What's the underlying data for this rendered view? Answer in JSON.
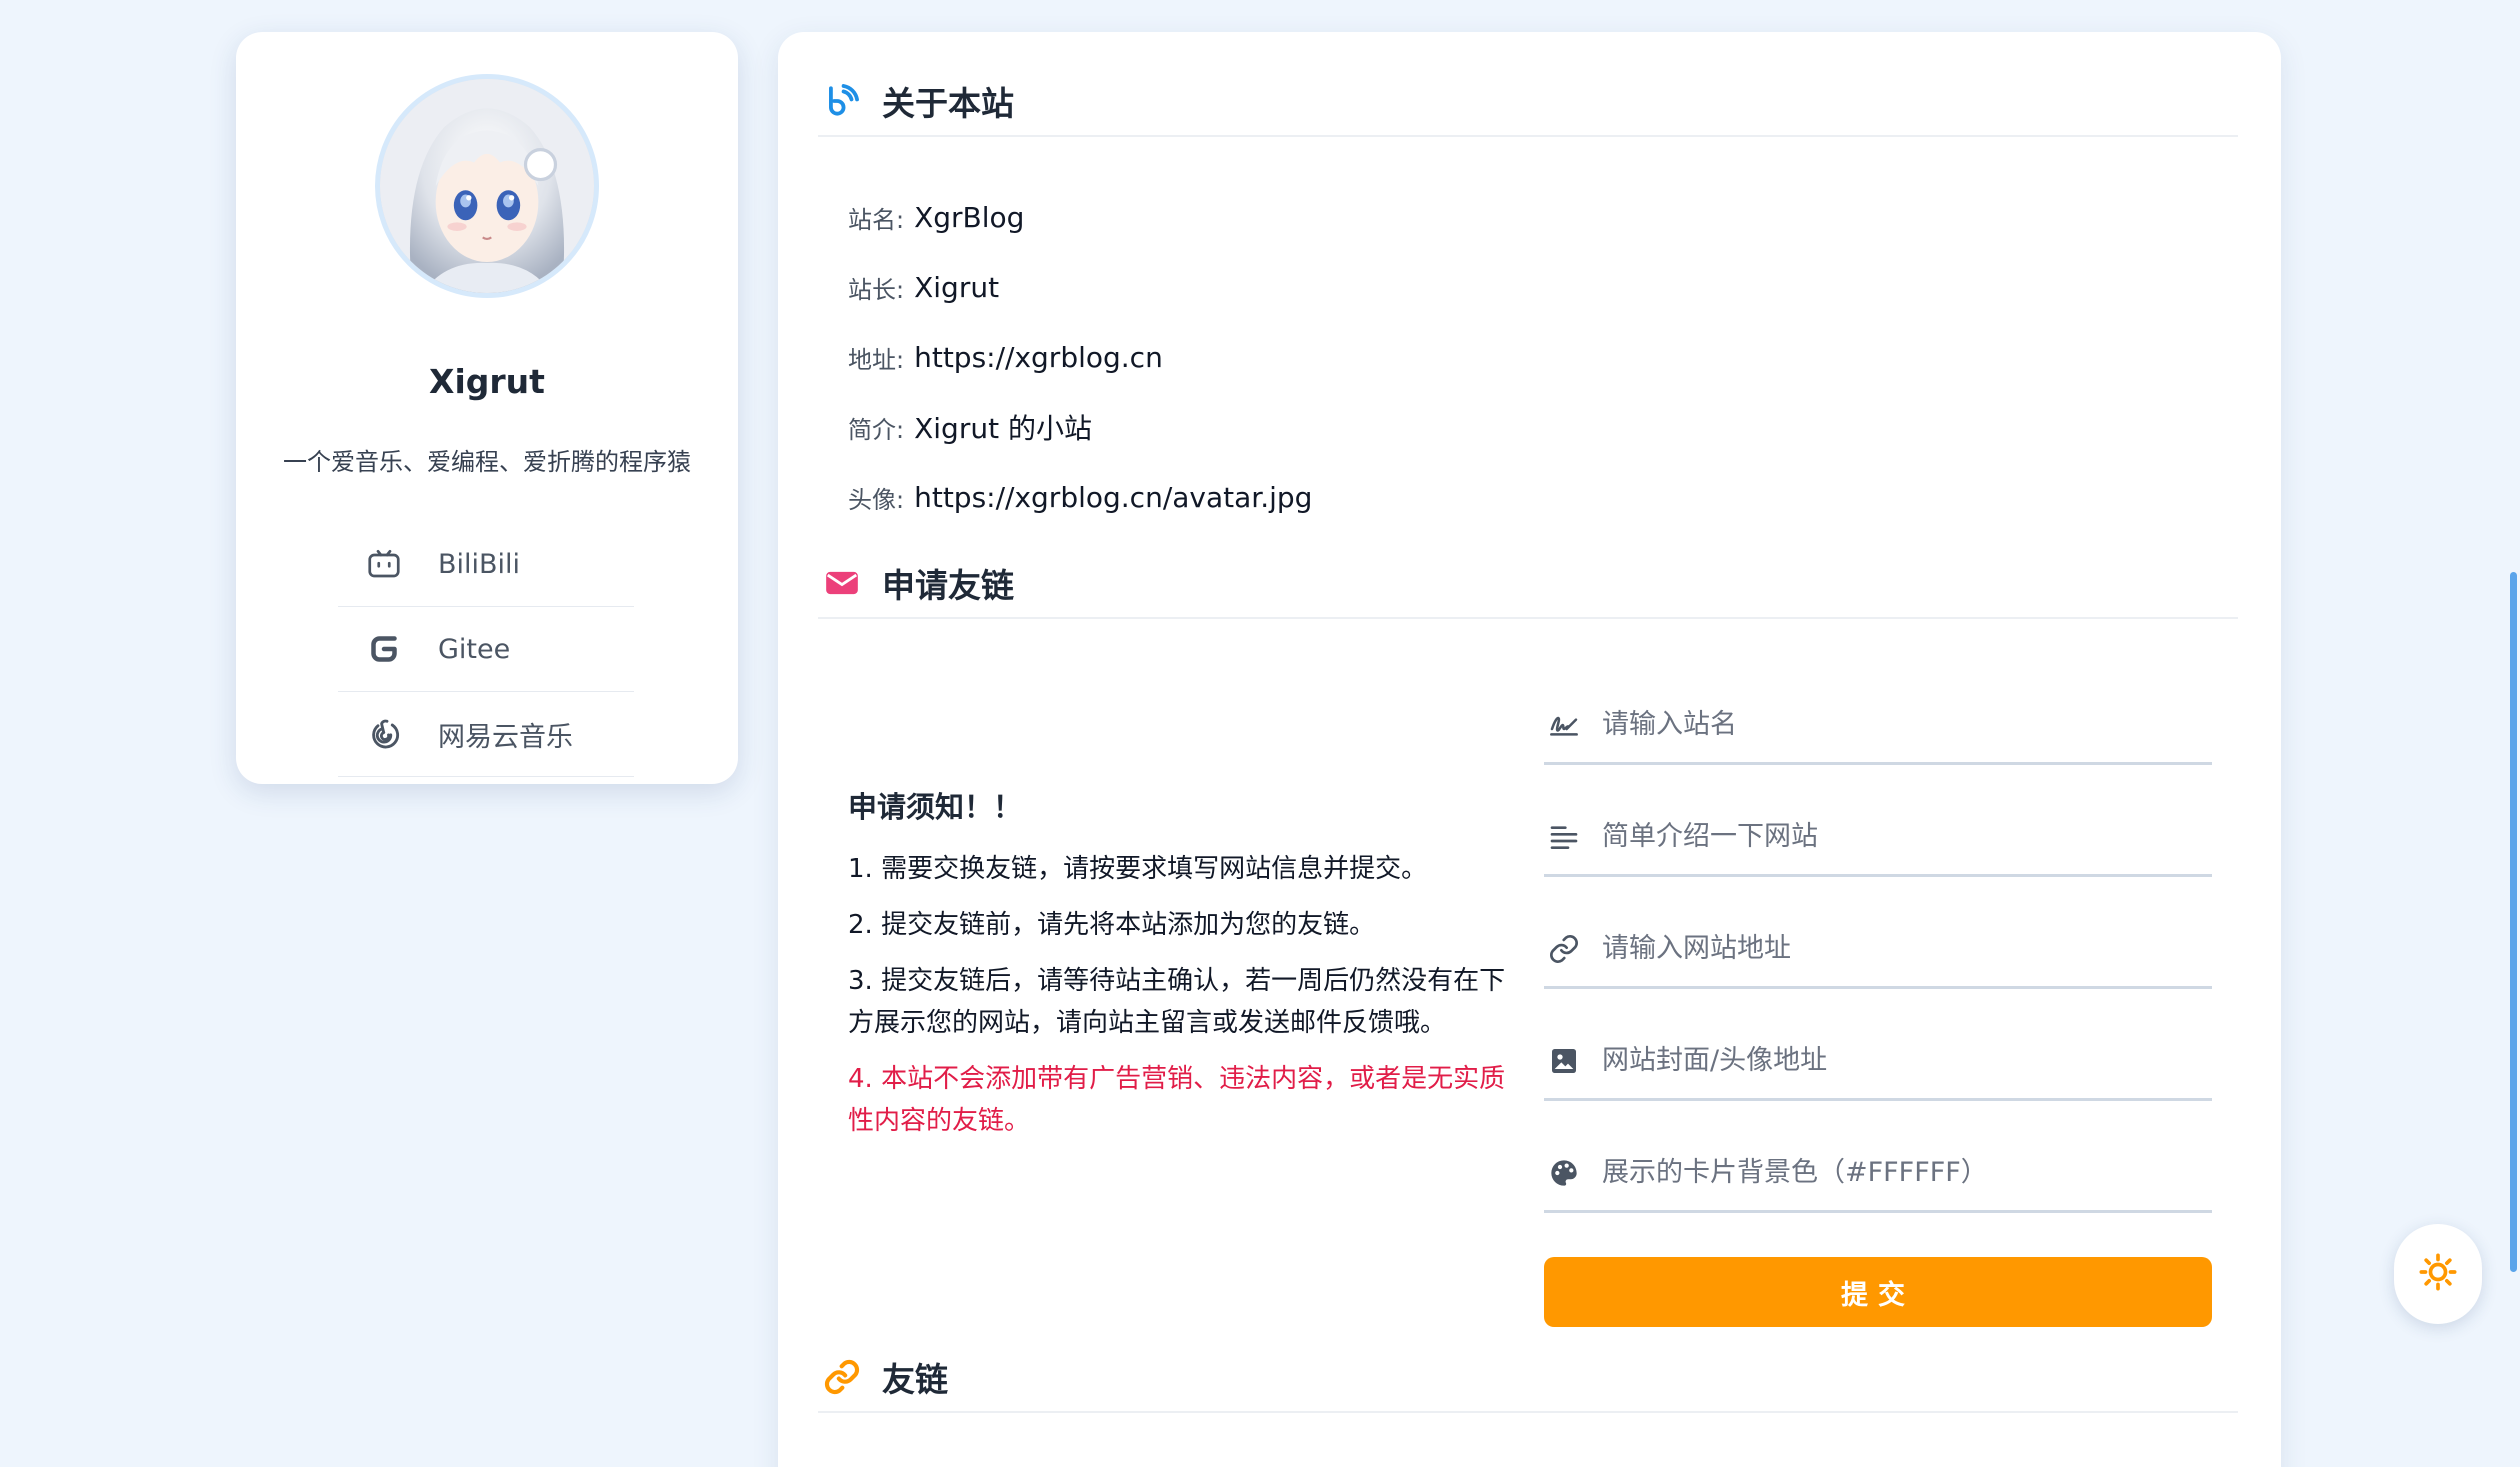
{
  "profile": {
    "name": "Xigrut",
    "bio": "一个爱音乐、爱编程、爱折腾的程序猿",
    "links": [
      {
        "label": "BiliBili",
        "icon": "bilibili-icon"
      },
      {
        "label": "Gitee",
        "icon": "gitee-icon"
      },
      {
        "label": "网易云音乐",
        "icon": "netease-music-icon"
      }
    ]
  },
  "about": {
    "title": "关于本站",
    "icon": "feed-icon",
    "rows": [
      {
        "key": "站名:",
        "value": "XgrBlog"
      },
      {
        "key": "站长:",
        "value": "Xigrut"
      },
      {
        "key": "地址:",
        "value": "https://xgrblog.cn"
      },
      {
        "key": "简介:",
        "value": "Xigrut 的小站"
      },
      {
        "key": "头像:",
        "value": "https://xgrblog.cn/avatar.jpg"
      }
    ]
  },
  "apply": {
    "title": "申请友链",
    "icon": "envelope-icon",
    "notice_title": "申请须知！！",
    "notices": [
      "1. 需要交换友链，请按要求填写网站信息并提交。",
      "2. 提交友链前，请先将本站添加为您的友链。",
      "3. 提交友链后，请等待站主确认，若一周后仍然没有在下方展示您的网站，请向站主留言或发送邮件反馈哦。"
    ],
    "warning": "4. 本站不会添加带有广告营销、违法内容，或者是无实质性内容的友链。",
    "fields": [
      {
        "placeholder": "请输入站名",
        "icon": "signature-icon"
      },
      {
        "placeholder": "简单介绍一下网站",
        "icon": "text-lines-icon"
      },
      {
        "placeholder": "请输入网站地址",
        "icon": "link-icon"
      },
      {
        "placeholder": "网站封面/头像地址",
        "icon": "image-icon"
      },
      {
        "placeholder": "展示的卡片背景色（#FFFFFF）",
        "icon": "palette-icon"
      }
    ],
    "submit_label": "提交"
  },
  "friends": {
    "title": "友链",
    "icon": "chain-link-icon"
  },
  "theme_toggle": {
    "icon": "sun-icon"
  },
  "colors": {
    "accent_orange": "#ff9800",
    "warning_red": "#e11d48",
    "feed_blue": "#1e8fe6",
    "envelope_pink": "#ec407a",
    "page_bg": "#eef5fd"
  }
}
